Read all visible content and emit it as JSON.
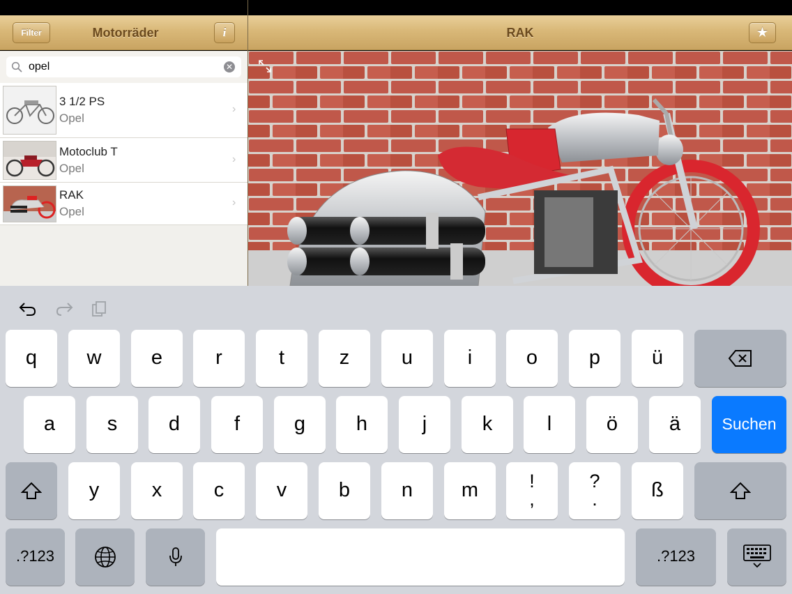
{
  "left_nav": {
    "filter_label": "Filter",
    "title": "Motorräder",
    "info_label": "i"
  },
  "right_nav": {
    "title": "RAK",
    "favorite_icon": "star-icon"
  },
  "search": {
    "value": "opel",
    "search_icon": "magnifier-icon",
    "clear_icon": "clear-circle-icon"
  },
  "results": [
    {
      "title": "3 1/2 PS",
      "maker": "Opel"
    },
    {
      "title": "Motoclub T",
      "maker": "Opel"
    },
    {
      "title": "RAK",
      "maker": "Opel"
    }
  ],
  "photo": {
    "expand_icon": "expand-arrows-icon"
  },
  "keyboard": {
    "toolbar": [
      "undo-icon",
      "redo-icon",
      "paste-icon"
    ],
    "row1": [
      "q",
      "w",
      "e",
      "r",
      "t",
      "z",
      "u",
      "i",
      "o",
      "p",
      "ü"
    ],
    "row2": [
      "a",
      "s",
      "d",
      "f",
      "g",
      "h",
      "j",
      "k",
      "l",
      "ö",
      "ä"
    ],
    "row3": [
      "y",
      "x",
      "c",
      "v",
      "b",
      "n",
      "m"
    ],
    "punct1": [
      "!",
      ","
    ],
    "punct2": [
      "?",
      "."
    ],
    "eszett": "ß",
    "search_label": "Suchen",
    "numbers_label": ".?123",
    "colors": {
      "search_key": "#0a7aff",
      "nav_tint": "#c9a462"
    }
  }
}
